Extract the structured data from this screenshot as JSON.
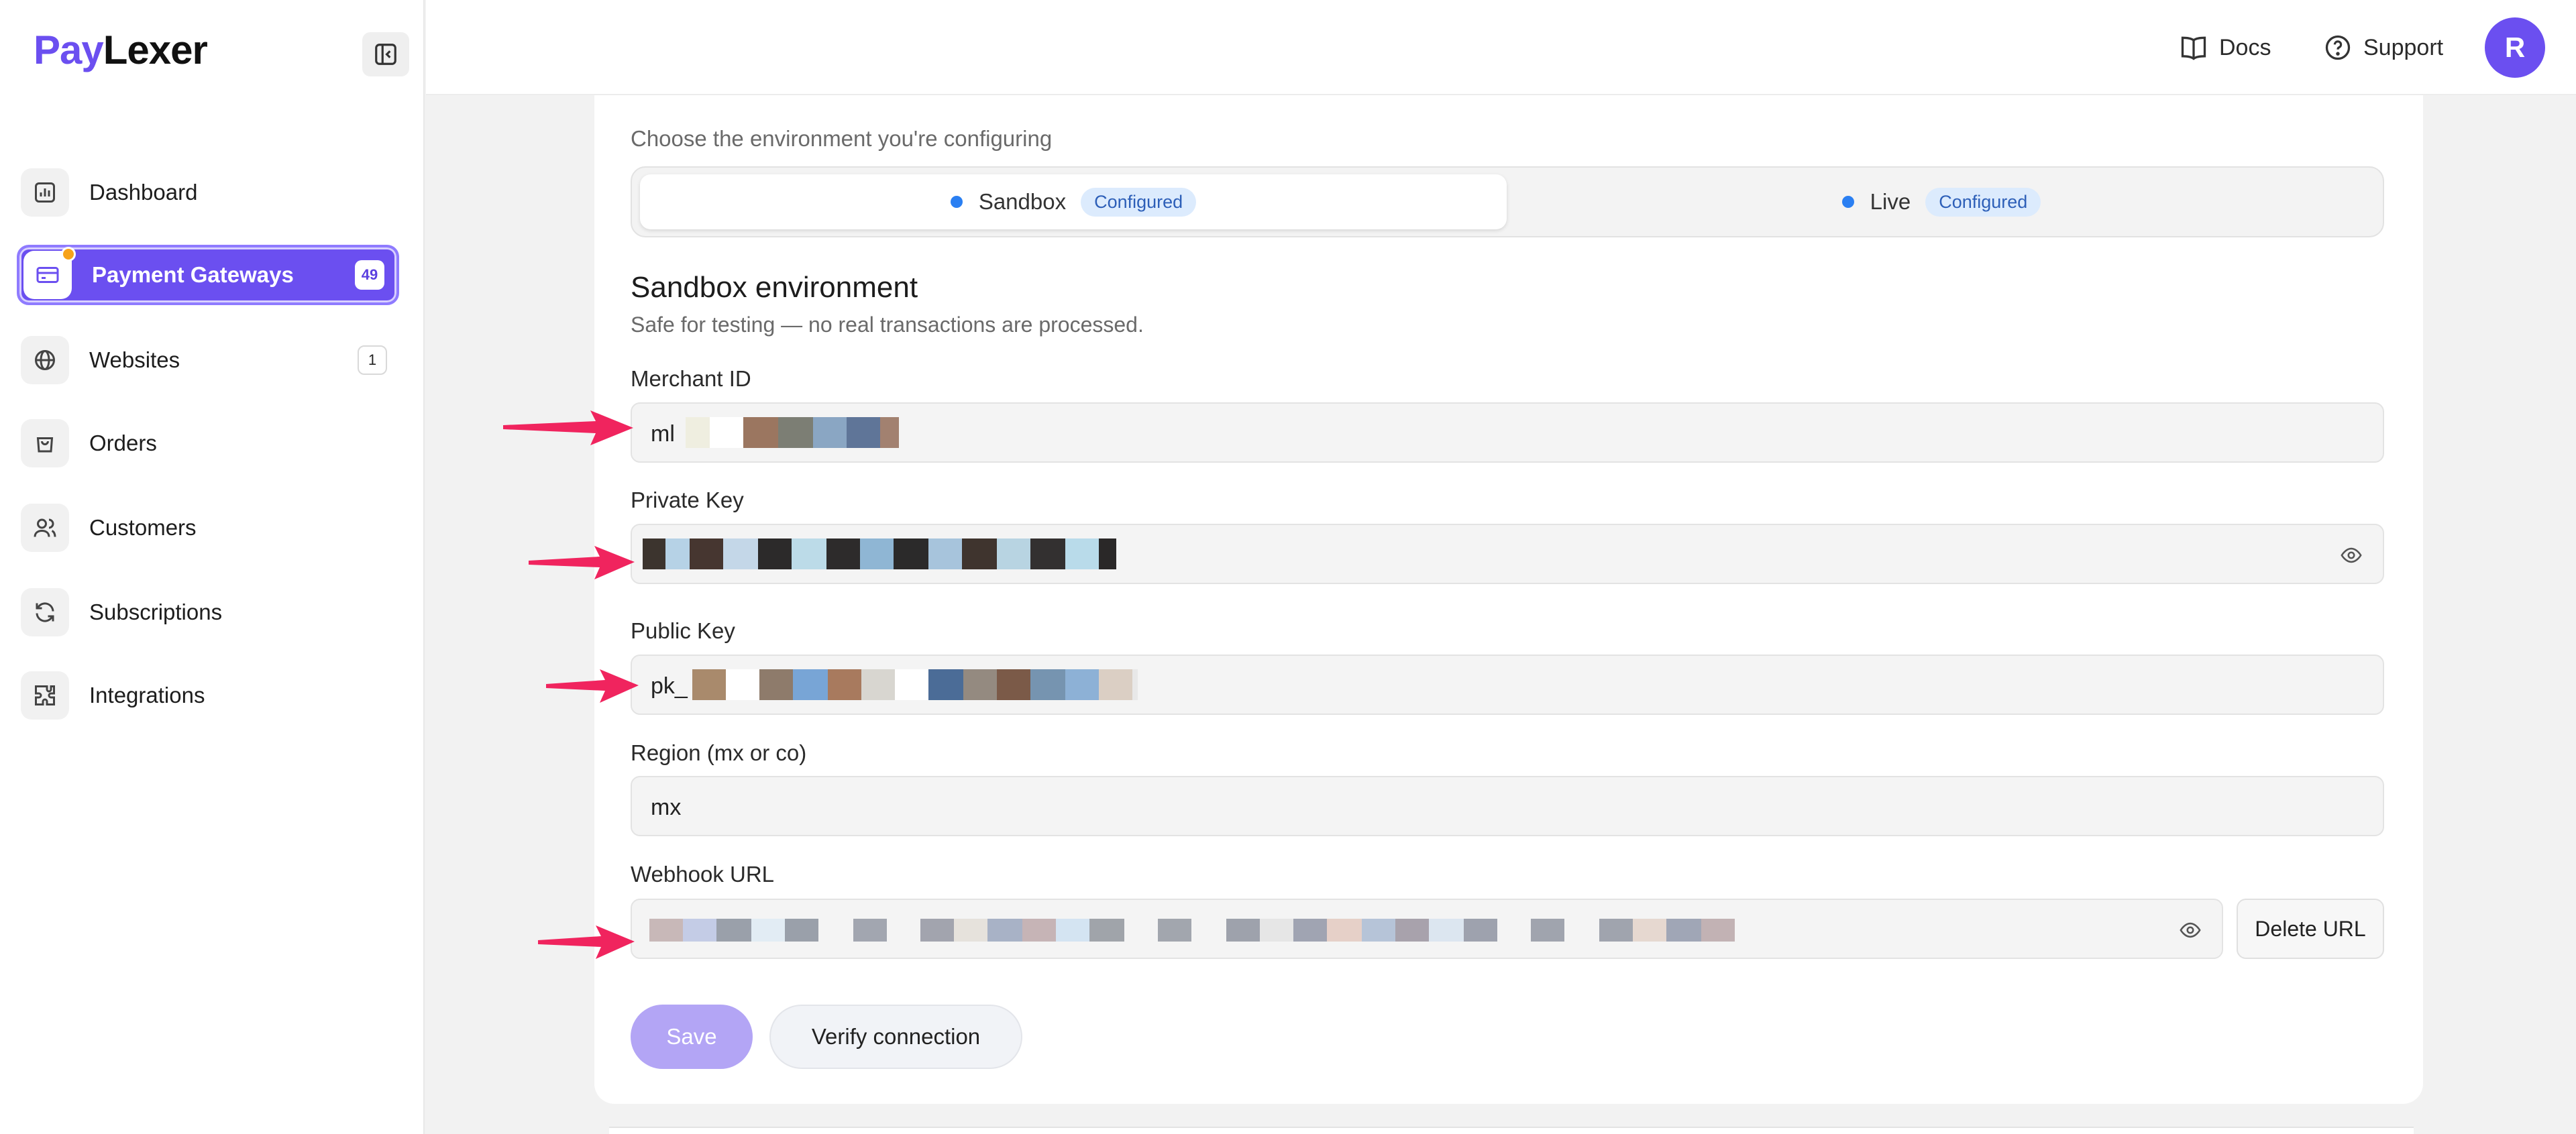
{
  "brand": {
    "part1": "Pay",
    "part2": "Lexer"
  },
  "sidebar": {
    "items": [
      {
        "label": "Dashboard",
        "icon": "bar-chart-icon"
      },
      {
        "label": "Payment Gateways",
        "icon": "credit-card-icon",
        "badge": "49",
        "active": true
      },
      {
        "label": "Websites",
        "icon": "globe-icon",
        "badge": "1"
      },
      {
        "label": "Orders",
        "icon": "shopping-bag-icon"
      },
      {
        "label": "Customers",
        "icon": "users-icon"
      },
      {
        "label": "Subscriptions",
        "icon": "refresh-icon"
      },
      {
        "label": "Integrations",
        "icon": "puzzle-icon"
      }
    ]
  },
  "topbar": {
    "docs": "Docs",
    "support": "Support",
    "avatar_initial": "R"
  },
  "environment": {
    "hint": "Choose the environment you're configuring",
    "options": [
      {
        "label": "Sandbox",
        "status": "Configured",
        "selected": true
      },
      {
        "label": "Live",
        "status": "Configured",
        "selected": false
      }
    ],
    "title": "Sandbox environment",
    "description": "Safe for testing — no real transactions are processed."
  },
  "fields": {
    "merchant_id": {
      "label": "Merchant ID",
      "value_prefix": "ml"
    },
    "private_key": {
      "label": "Private Key"
    },
    "public_key": {
      "label": "Public Key",
      "value_prefix": "pk_"
    },
    "region": {
      "label": "Region (mx or co)",
      "value": "mx"
    },
    "webhook_url": {
      "label": "Webhook URL"
    }
  },
  "actions": {
    "delete_url": "Delete URL",
    "save": "Save",
    "verify": "Verify connection"
  },
  "colors": {
    "accent": "#6b4ff0",
    "annotation_arrow": "#f0245e",
    "status_dot": "#2a7ff2"
  }
}
